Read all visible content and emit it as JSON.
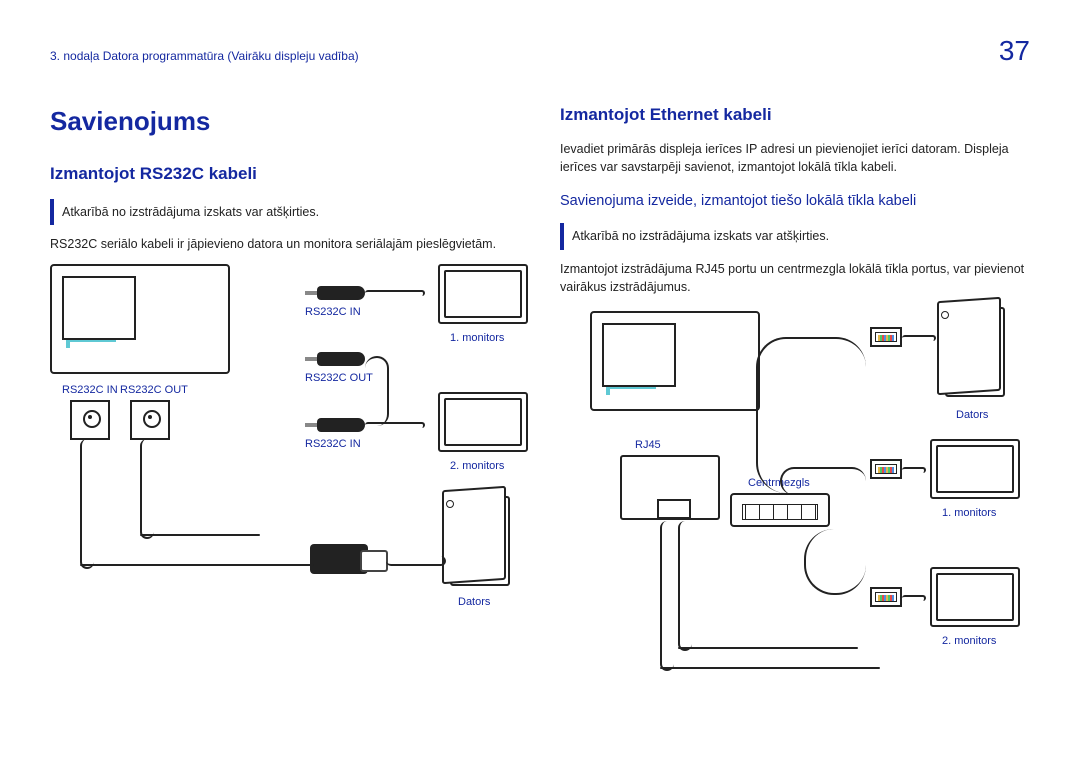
{
  "page": {
    "breadcrumb": "3. nodaļa Datora programmatūra (Vairāku displeju vadība)",
    "number": "37"
  },
  "left": {
    "h1": "Savienojums",
    "h2": "Izmantojot RS232C kabeli",
    "note": "Atkarībā no izstrādājuma izskats var atšķirties.",
    "body": "RS232C seriālo kabeli ir jāpievieno datora un monitora seriālajām pieslēgvietām.",
    "labels": {
      "rs232c_in": "RS232C IN",
      "rs232c_out": "RS232C OUT",
      "rs232c_in_2": "RS232C IN",
      "rs232c_out_2": "RS232C OUT",
      "rs232c_in_3": "RS232C IN",
      "monitor1": "1. monitors",
      "monitor2": "2. monitors",
      "dators": "Dators"
    }
  },
  "right": {
    "h2": "Izmantojot Ethernet kabeli",
    "body1": "Ievadiet primārās displeja ierīces IP adresi un pievienojiet ierīci datoram. Displeja ierīces var savstarpēji savienot, izmantojot lokālā tīkla kabeli.",
    "h3": "Savienojuma izveide, izmantojot tiešo lokālā tīkla kabeli",
    "note": "Atkarībā no izstrādājuma izskats var atšķirties.",
    "body2": "Izmantojot izstrādājuma RJ45 portu un centrmezgla lokālā tīkla portus, var pievienot vairākus izstrādājumus.",
    "labels": {
      "rj45": "RJ45",
      "centrmezgls": "Centrmezgls",
      "dators": "Dators",
      "monitor1": "1. monitors",
      "monitor2": "2. monitors"
    }
  }
}
